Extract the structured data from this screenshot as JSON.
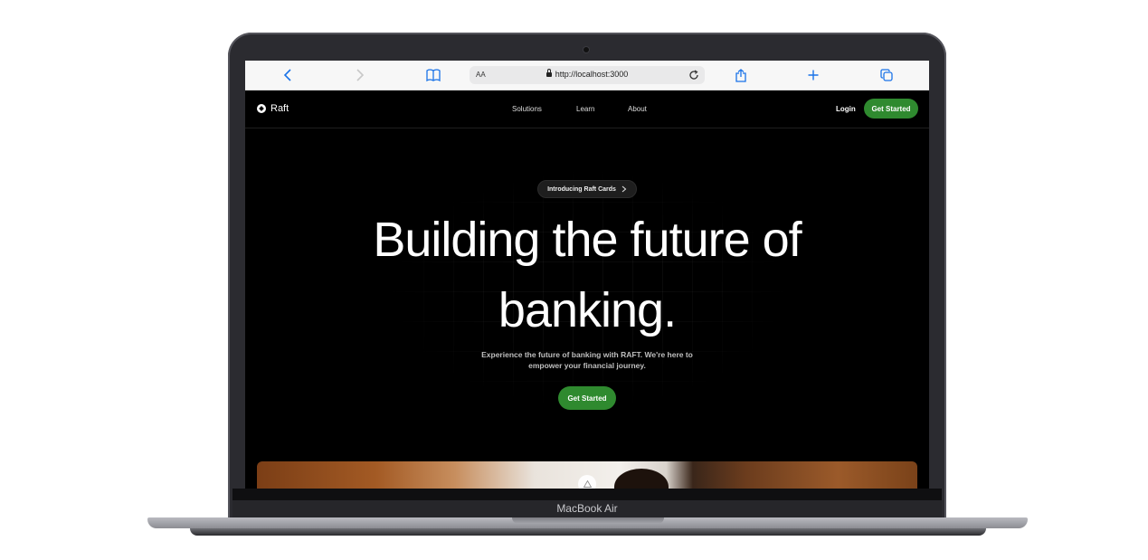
{
  "device": {
    "label": "MacBook Air"
  },
  "browser": {
    "text_size_label": "AA",
    "url": "http://localhost:3000"
  },
  "site": {
    "brand": "Raft",
    "nav": [
      {
        "label": "Solutions"
      },
      {
        "label": "Learn"
      },
      {
        "label": "About"
      }
    ],
    "login_label": "Login",
    "get_started_label": "Get Started",
    "announcement": "Introducing Raft Cards",
    "headline": "Building the future of banking.",
    "subtext": "Experience the future of banking with RAFT. We're here to empower your financial journey.",
    "hero_cta_label": "Get Started"
  },
  "colors": {
    "accent": "#2f8a2f",
    "background": "#000000",
    "browser_link": "#1a73e8"
  }
}
